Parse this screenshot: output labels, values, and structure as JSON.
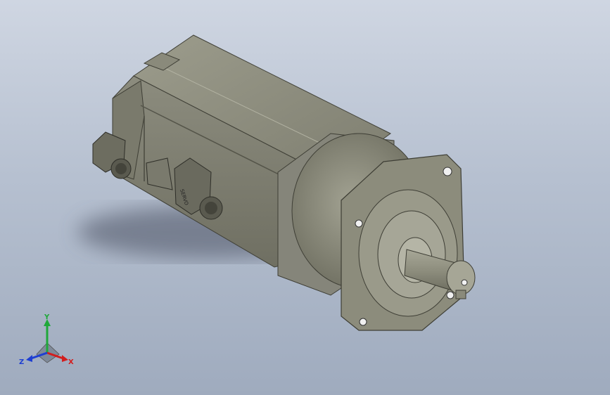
{
  "viewport": {
    "background_top": "#cfd6e2",
    "background_bottom": "#9fabbe",
    "model_color": "#8f8f80"
  },
  "triad": {
    "x_label": "X",
    "y_label": "Y",
    "z_label": "Z",
    "x_color": "#d21e1e",
    "y_color": "#1fa83a",
    "z_color": "#1e3fd2"
  },
  "model": {
    "connector_text": "SERVO"
  }
}
